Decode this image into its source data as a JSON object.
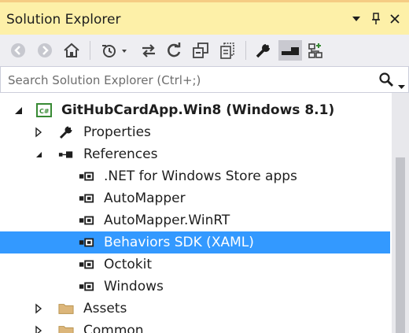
{
  "window": {
    "title": "Solution Explorer",
    "dropdown_icon": "chevron-down-icon",
    "pin_icon": "pin-icon",
    "close_icon": "close-icon",
    "accent_color": "#fdf0a8"
  },
  "toolbar": {
    "buttons": [
      {
        "name": "back-button",
        "icon": "back-arrow-icon"
      },
      {
        "name": "forward-button",
        "icon": "forward-arrow-icon"
      },
      {
        "name": "home-button",
        "icon": "home-icon"
      },
      {
        "name": "pending-changes-filter-button",
        "icon": "clock-icon"
      },
      {
        "name": "sync-with-active-document-button",
        "icon": "sync-arrows-icon"
      },
      {
        "name": "refresh-button",
        "icon": "refresh-icon"
      },
      {
        "name": "collapse-all-button",
        "icon": "collapse-all-icon"
      },
      {
        "name": "show-all-files-button",
        "icon": "show-all-files-icon"
      },
      {
        "name": "properties-button",
        "icon": "wrench-icon"
      },
      {
        "name": "preview-selected-items-button",
        "icon": "preview-icon"
      },
      {
        "name": "view-class-diagram-button",
        "icon": "class-diagram-icon"
      }
    ]
  },
  "search": {
    "placeholder": "Search Solution Explorer (Ctrl+;)"
  },
  "tree": {
    "items": [
      {
        "label": "GitHubCardApp.Win8 (Windows 8.1)",
        "icon": "csharp-project-icon",
        "expanded": true,
        "bold": true
      },
      {
        "label": "Properties",
        "icon": "wrench-icon",
        "expanded": false
      },
      {
        "label": "References",
        "icon": "references-icon",
        "expanded": true
      },
      {
        "label": ".NET for Windows Store apps",
        "icon": "reference-icon"
      },
      {
        "label": "AutoMapper",
        "icon": "reference-icon"
      },
      {
        "label": "AutoMapper.WinRT",
        "icon": "reference-icon"
      },
      {
        "label": "Behaviors SDK (XAML)",
        "icon": "reference-icon",
        "selected": true
      },
      {
        "label": "Octokit",
        "icon": "reference-icon"
      },
      {
        "label": "Windows",
        "icon": "reference-icon"
      },
      {
        "label": "Assets",
        "icon": "folder-icon",
        "expanded": false
      },
      {
        "label": "Common",
        "icon": "folder-icon",
        "expanded": false
      }
    ],
    "selection_color": "#3399ff"
  }
}
